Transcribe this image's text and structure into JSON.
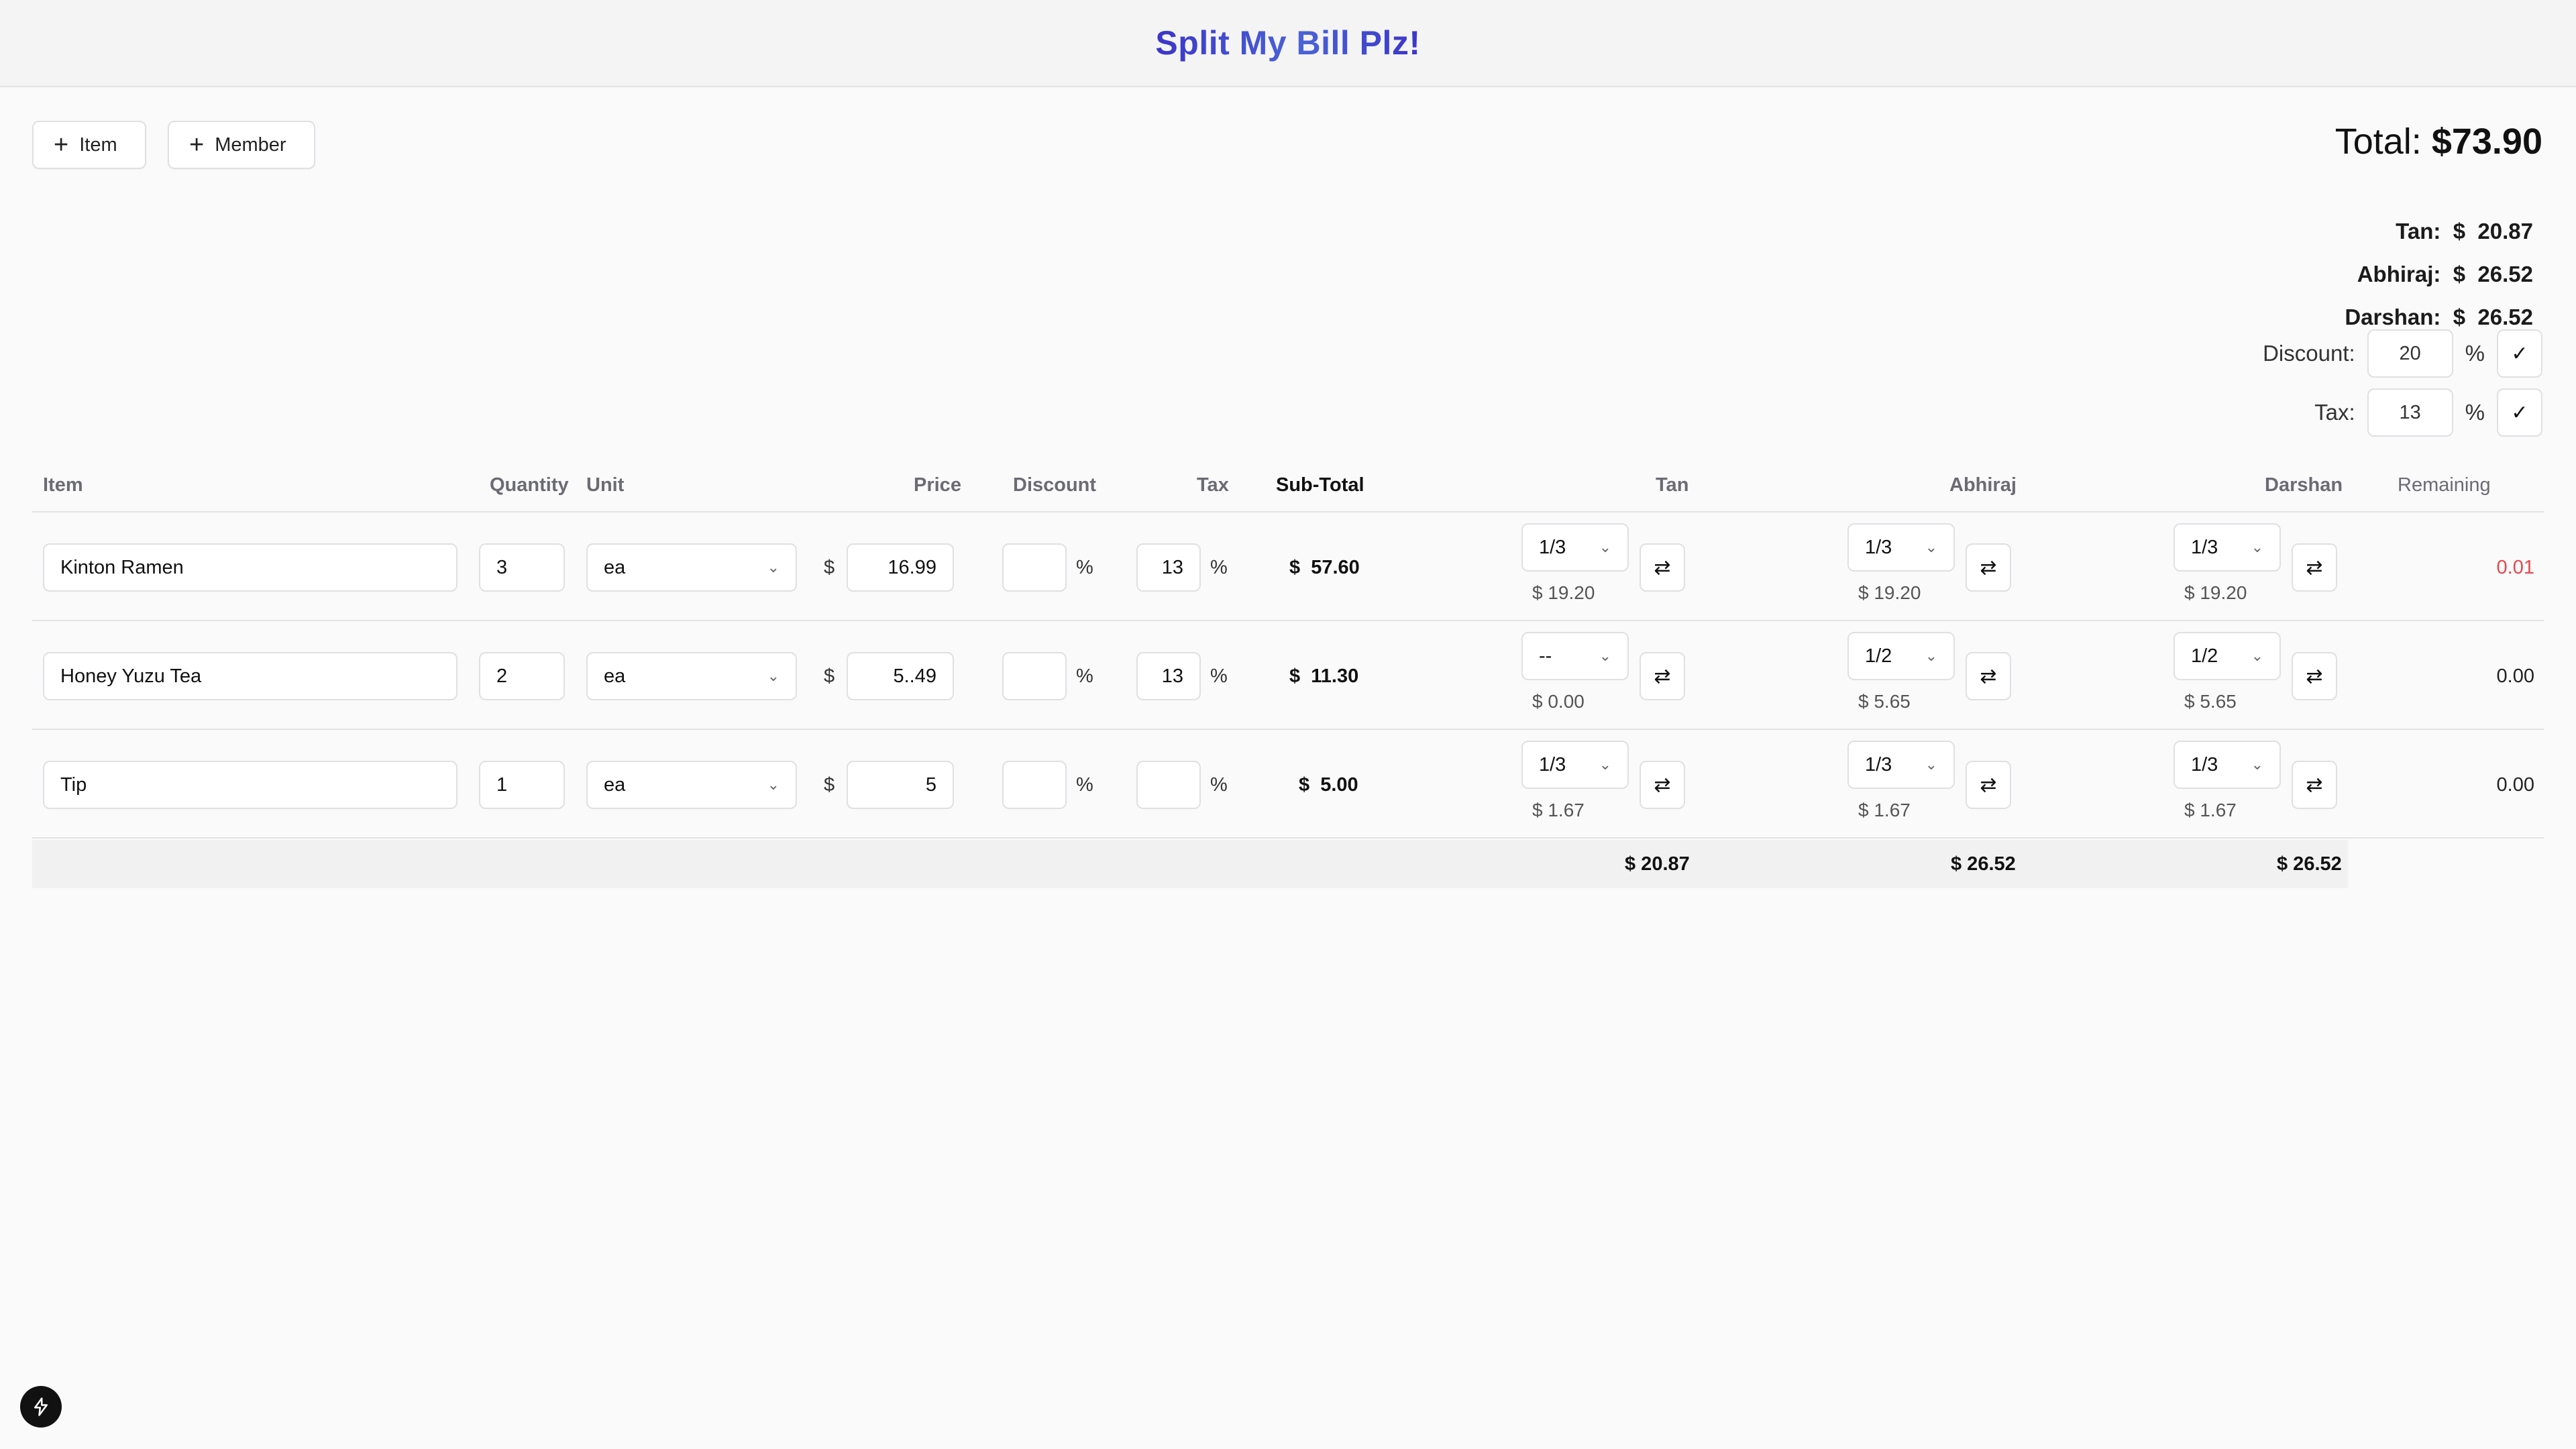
{
  "app": {
    "title": "Split My Bill Plz!"
  },
  "toolbar": {
    "add_item_label": "Item",
    "add_member_label": "Member"
  },
  "summary": {
    "total_label": "Total:",
    "total_value": "$73.90",
    "members": [
      {
        "name": "Tan:",
        "amount": "$  20.87"
      },
      {
        "name": "Abhiraj:",
        "amount": "$  26.52"
      },
      {
        "name": "Darshan:",
        "amount": "$  26.52"
      }
    ],
    "discount": {
      "label": "Discount:",
      "value": "20",
      "unit": "%"
    },
    "tax": {
      "label": "Tax:",
      "value": "13",
      "unit": "%"
    }
  },
  "table": {
    "headers": {
      "item": "Item",
      "quantity": "Quantity",
      "unit": "Unit",
      "price": "Price",
      "discount": "Discount",
      "tax": "Tax",
      "subtotal": "Sub-Total",
      "member1": "Tan",
      "member2": "Abhiraj",
      "member3": "Darshan",
      "remaining": "Remaining"
    },
    "rows": [
      {
        "item": "Kinton Ramen",
        "quantity": "3",
        "unit": "ea",
        "currency": "$",
        "price": "16.99",
        "discount": "",
        "discount_unit": "%",
        "tax": "13",
        "tax_unit": "%",
        "subtotal": "$  57.60",
        "shares": [
          {
            "fraction": "1/3",
            "amount": "$ 19.20"
          },
          {
            "fraction": "1/3",
            "amount": "$ 19.20"
          },
          {
            "fraction": "1/3",
            "amount": "$ 19.20"
          }
        ],
        "remaining": "0.01"
      },
      {
        "item": "Honey Yuzu Tea",
        "quantity": "2",
        "unit": "ea",
        "currency": "$",
        "price": "5..49",
        "discount": "",
        "discount_unit": "%",
        "tax": "13",
        "tax_unit": "%",
        "subtotal": "$  11.30",
        "shares": [
          {
            "fraction": "--",
            "amount": "$ 0.00"
          },
          {
            "fraction": "1/2",
            "amount": "$ 5.65"
          },
          {
            "fraction": "1/2",
            "amount": "$ 5.65"
          }
        ],
        "remaining": "0.00"
      },
      {
        "item": "Tip",
        "quantity": "1",
        "unit": "ea",
        "currency": "$",
        "price": "5",
        "discount": "",
        "discount_unit": "%",
        "tax": "",
        "tax_unit": "%",
        "subtotal": "$  5.00",
        "shares": [
          {
            "fraction": "1/3",
            "amount": "$ 1.67"
          },
          {
            "fraction": "1/3",
            "amount": "$ 1.67"
          },
          {
            "fraction": "1/3",
            "amount": "$ 1.67"
          }
        ],
        "remaining": "0.00"
      }
    ],
    "footer_totals": [
      "$ 20.87",
      "$ 26.52",
      "$ 26.52"
    ]
  },
  "colors": {
    "title_gradient_start": "#3b35c9",
    "title_gradient_mid": "#4a63d6",
    "remaining_alert": "#e5484d"
  },
  "icons": {
    "add": "plus-icon",
    "confirm": "check-icon",
    "swap": "swap-arrows-icon",
    "dropdown": "chevron-down-icon",
    "dev": "lightning-icon"
  }
}
